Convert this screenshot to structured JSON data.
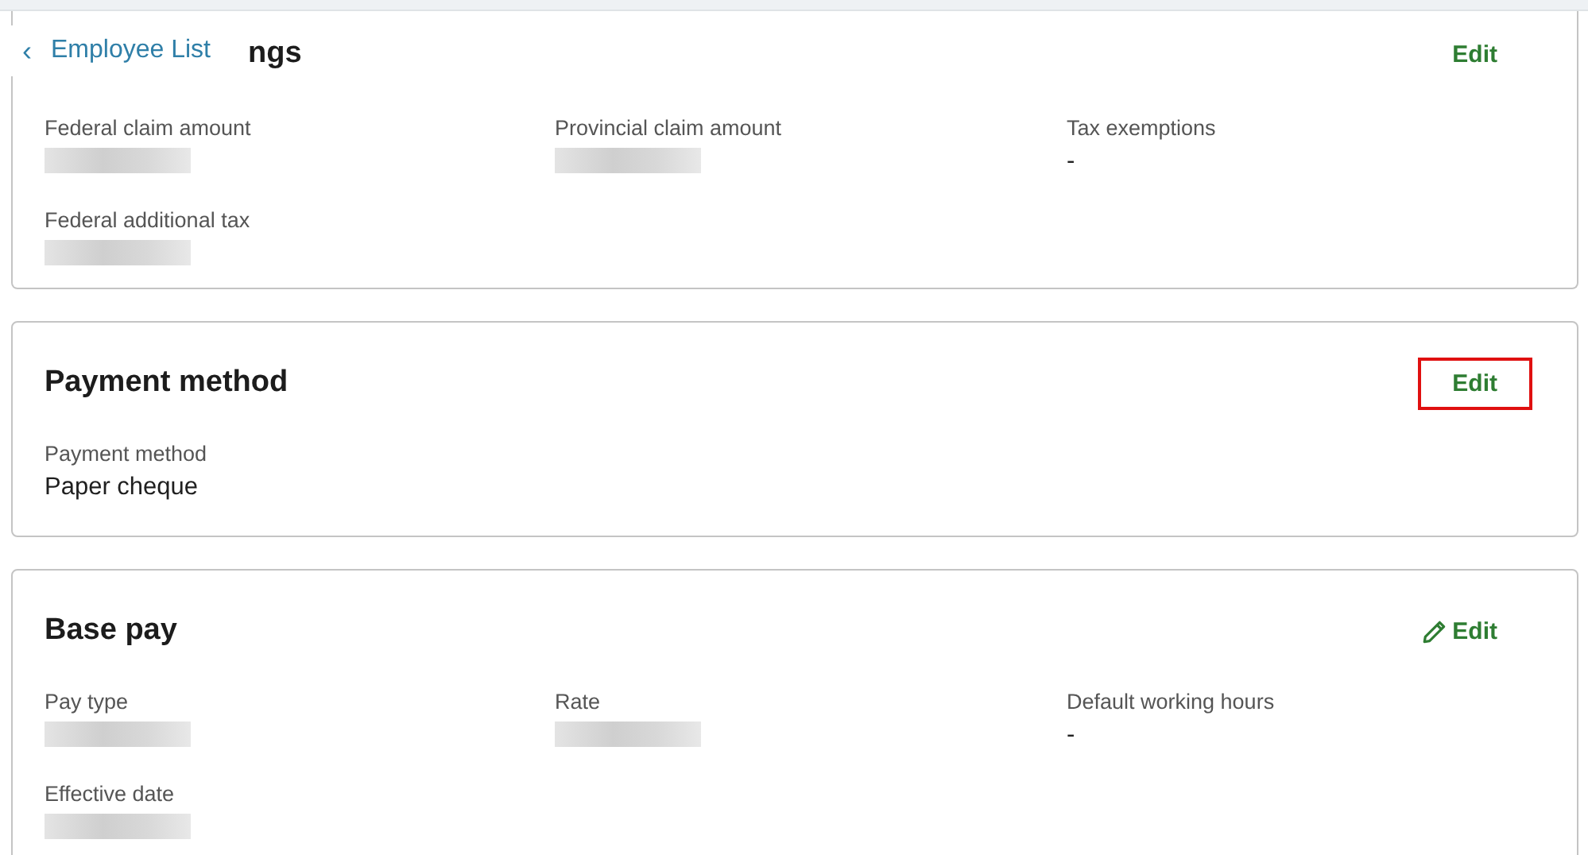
{
  "back_link": {
    "chevron": "‹",
    "label": "Employee List"
  },
  "sections": [
    {
      "title": "ngs",
      "edit": {
        "label": "Edit",
        "icon": false,
        "highlighted": false
      },
      "cut_top": true,
      "fields": [
        {
          "label": "Federal claim amount",
          "kind": "redacted"
        },
        {
          "label": "Provincial claim amount",
          "kind": "redacted"
        },
        {
          "label": "Tax exemptions",
          "kind": "text",
          "value": "-"
        },
        {
          "label": "Federal additional tax",
          "kind": "redacted"
        }
      ]
    },
    {
      "title": "Payment method",
      "edit": {
        "label": "Edit",
        "icon": false,
        "highlighted": true
      },
      "cut_top": false,
      "fields": [
        {
          "label": "Payment method",
          "kind": "text",
          "value": "Paper cheque"
        }
      ]
    },
    {
      "title": "Base pay",
      "edit": {
        "label": "Edit",
        "icon": true,
        "highlighted": false
      },
      "cut_top": false,
      "fields": [
        {
          "label": "Pay type",
          "kind": "redacted"
        },
        {
          "label": "Rate",
          "kind": "redacted"
        },
        {
          "label": "Default working hours",
          "kind": "text",
          "value": "-"
        },
        {
          "label": "Effective date",
          "kind": "redacted"
        }
      ]
    }
  ]
}
